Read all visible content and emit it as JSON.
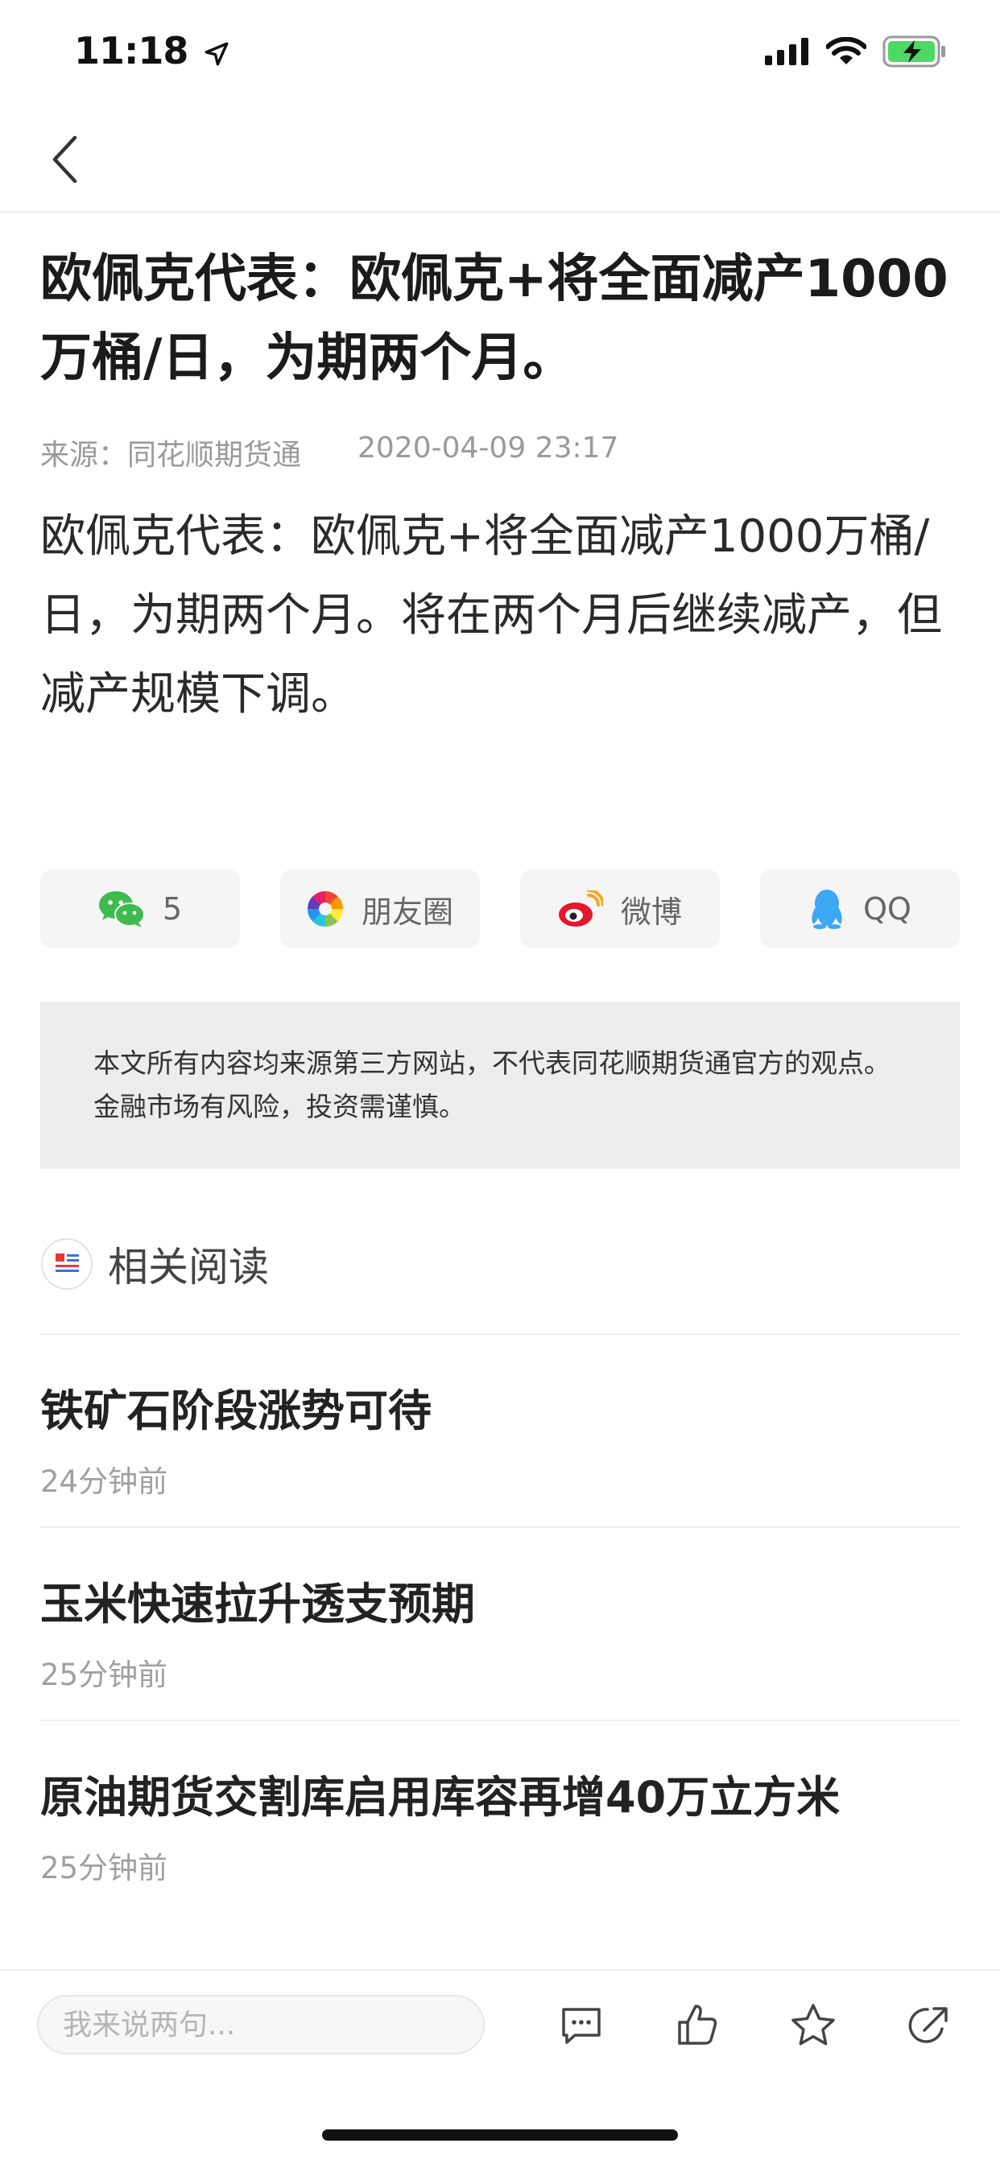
{
  "status_bar": {
    "time": "11:18"
  },
  "article": {
    "headline": "欧佩克代表：欧佩克+将全面减产1000万桶/日，为期两个月。",
    "source": "来源：同花顺期货通",
    "datetime": "2020-04-09 23:17",
    "body": "欧佩克代表：欧佩克+将全面减产1000万桶/日，为期两个月。将在两个月后继续减产，但减产规模下调。"
  },
  "share": {
    "wechat_count": "5",
    "moments_label": "朋友圈",
    "weibo_label": "微博",
    "qq_label": "QQ"
  },
  "disclaimer": "本文所有内容均来源第三方网站，不代表同花顺期货通官方的观点。金融市场有风险，投资需谨慎。",
  "related": {
    "title": "相关阅读",
    "items": [
      {
        "title": "铁矿石阶段涨势可待",
        "time": "24分钟前"
      },
      {
        "title": "玉米快速拉升透支预期",
        "time": "25分钟前"
      },
      {
        "title": "原油期货交割库启用库容再增40万立方米",
        "time": "25分钟前"
      }
    ]
  },
  "bottom_bar": {
    "comment_placeholder": "我来说两句..."
  },
  "colors": {
    "wechat": "#3dbb4e",
    "weibo": "#e6162d",
    "qq": "#3ca7f3",
    "battery": "#4cd964"
  },
  "icons": [
    "location-arrow-icon",
    "signal-icon",
    "wifi-icon",
    "battery-charging-icon",
    "back-chevron-icon",
    "wechat-icon",
    "moments-icon",
    "weibo-icon",
    "qq-icon",
    "news-icon",
    "comment-icon",
    "thumbs-up-icon",
    "star-icon",
    "share-icon"
  ]
}
